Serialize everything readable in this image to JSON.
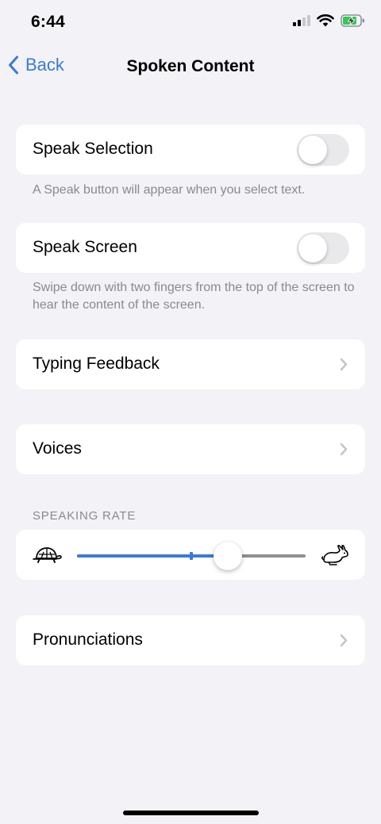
{
  "status_bar": {
    "time": "6:44"
  },
  "nav": {
    "back_label": "Back",
    "title": "Spoken Content"
  },
  "speak_selection": {
    "label": "Speak Selection",
    "enabled": false,
    "footnote": "A Speak button will appear when you select text."
  },
  "speak_screen": {
    "label": "Speak Screen",
    "enabled": false,
    "footnote": "Swipe down with two fingers from the top of the screen to hear the content of the screen."
  },
  "typing_feedback": {
    "label": "Typing Feedback"
  },
  "voices": {
    "label": "Voices"
  },
  "speaking_rate": {
    "header": "SPEAKING RATE",
    "value_fraction": 0.66,
    "default_fraction": 0.5,
    "slow_icon": "turtle-icon",
    "fast_icon": "rabbit-icon"
  },
  "pronunciations": {
    "label": "Pronunciations"
  },
  "colors": {
    "accent": "#3a7bd5",
    "background": "#f2f2f7",
    "secondary_text": "#8a8a8e",
    "toggle_off": "#e9e9eb",
    "chevron": "#c4c4c7",
    "battery_charging": "#34c759"
  }
}
